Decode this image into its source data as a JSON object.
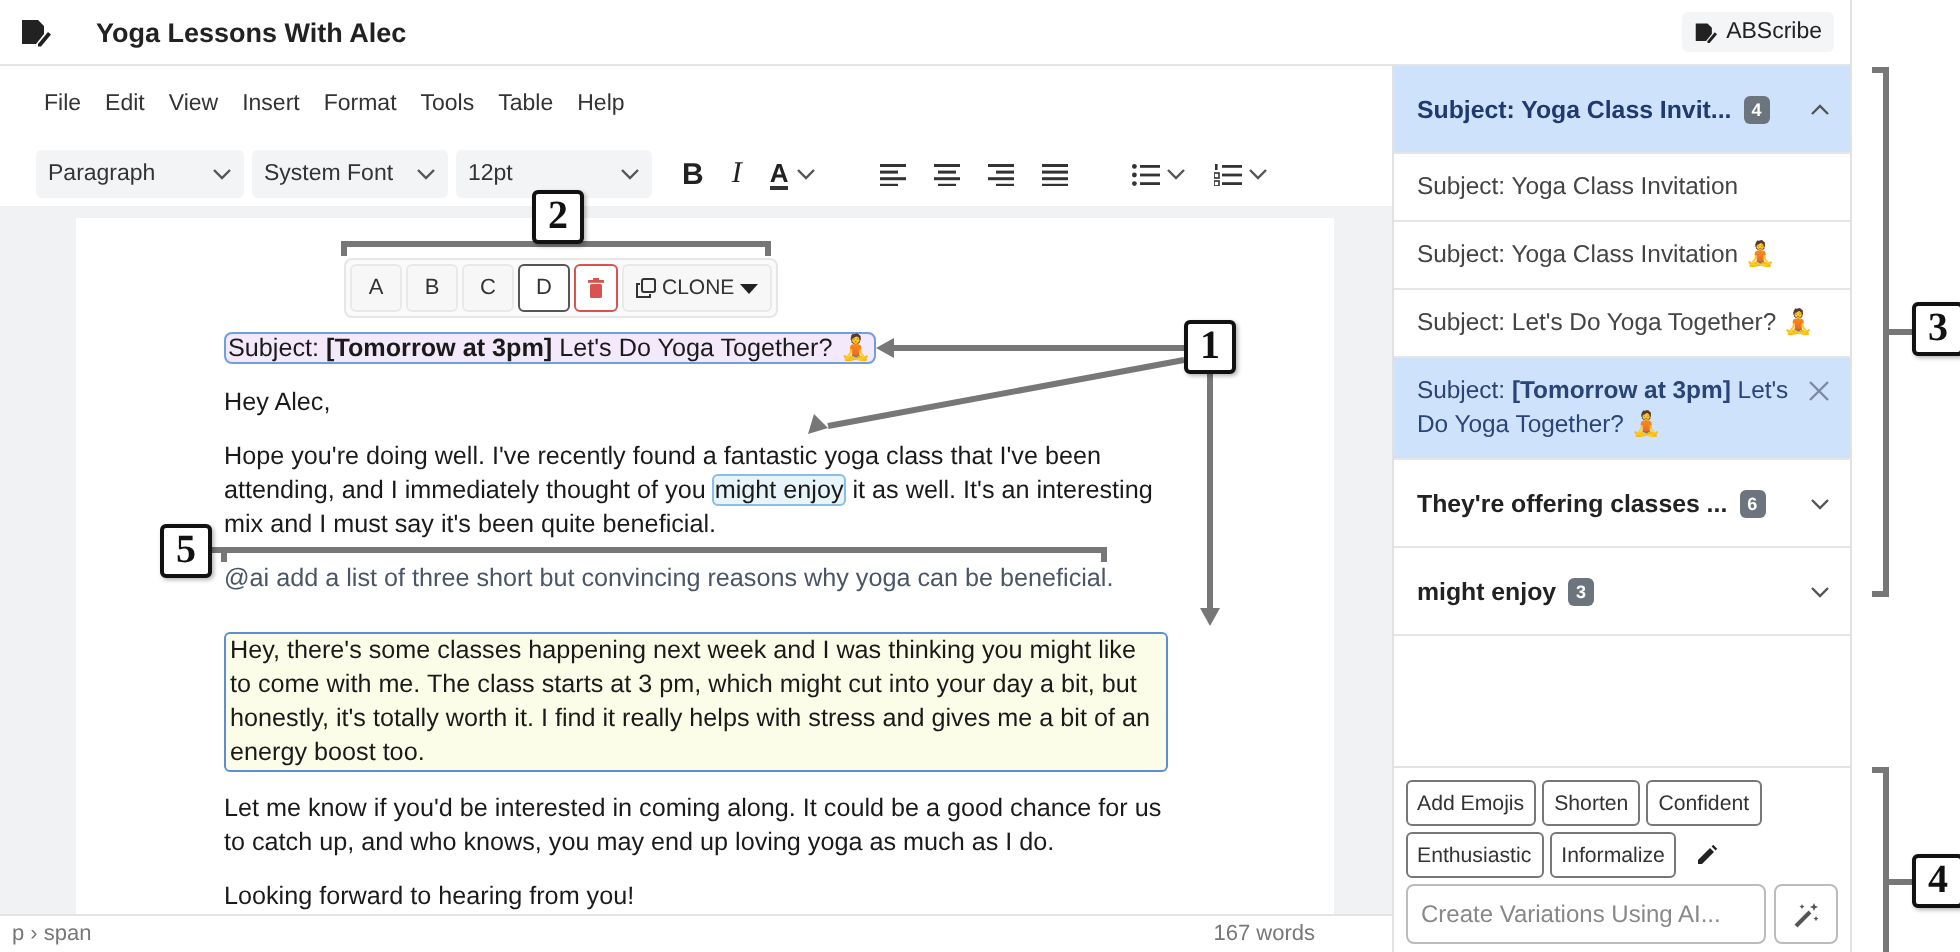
{
  "app": {
    "title": "Yoga Lessons With Alec",
    "brand": "ABScribe"
  },
  "menu": [
    "File",
    "Edit",
    "View",
    "Insert",
    "Format",
    "Tools",
    "Table",
    "Help"
  ],
  "toolbar": {
    "block_format": "Paragraph",
    "font": "System Font",
    "size": "12pt",
    "format_buttons": [
      {
        "kind": "bold",
        "label": "B"
      },
      {
        "kind": "italic",
        "label": "I"
      },
      {
        "kind": "text_color",
        "label": "A"
      }
    ]
  },
  "variation_bar": {
    "variations": [
      {
        "label": "A",
        "selected": false
      },
      {
        "label": "B",
        "selected": false
      },
      {
        "label": "C",
        "selected": false
      },
      {
        "label": "D",
        "selected": true
      }
    ],
    "clone": "CLONE"
  },
  "document": {
    "paragraphs": [
      {
        "kind": "subject",
        "text": "Subject: **[Tomorrow at 3pm]** Let's Do Yoga Together? 🧘"
      },
      {
        "kind": "plain",
        "text": "Hey Alec,"
      },
      {
        "kind": "segmented",
        "segments": [
          {
            "text": "Hope you're doing well. I've recently found a fantastic yoga class that I've been attending, and I immediately thought of you ",
            "highlighted": false
          },
          {
            "text": "might enjoy",
            "highlighted": true
          },
          {
            "text": " it as well. It's an interesting mix and I must say it's been quite beneficial.",
            "highlighted": false
          }
        ]
      },
      {
        "kind": "ai_prompt",
        "text": "@ai add a list of three short but convincing reasons why yoga can be beneficial."
      },
      {
        "kind": "variation",
        "text": "Hey, there's some classes happening next week and I was thinking you might like to come with me. The class starts at 3 pm, which might cut into your day a bit, but honestly, it's totally worth it. I find it really helps with stress and gives me a bit of an energy boost too."
      },
      {
        "kind": "plain",
        "text": "Let me know if you'd be interested in coming along. It could be a good chance for us to catch up, and who knows, you may end up loving yoga as much as I do."
      },
      {
        "kind": "plain",
        "text": "Looking forward to hearing from you!"
      }
    ]
  },
  "status_bar": {
    "path": "p › span",
    "word_count": "167 words"
  },
  "sidebar": {
    "groups": [
      {
        "title": "Subject: Yoga Class Invit...",
        "count": "4",
        "expanded": true,
        "variations": [
          {
            "text": "Subject: Yoga Class Invitation",
            "selected": false
          },
          {
            "text": "Subject: Yoga Class Invitation 🧘",
            "selected": false
          },
          {
            "text": "Subject: Let's Do Yoga Together? 🧘",
            "selected": false
          },
          {
            "text": "Subject: **[Tomorrow at 3pm]** Let's Do Yoga Together? 🧘",
            "selected": true
          }
        ]
      },
      {
        "title": "They're offering classes ...",
        "count": "6",
        "expanded": false
      },
      {
        "title": "might enjoy",
        "count": "3",
        "expanded": false
      }
    ]
  },
  "ai_controls": {
    "recipes": [
      "Add Emojis",
      "Shorten",
      "Confident",
      "Enthusiastic",
      "Informalize"
    ],
    "placeholder": "Create Variations Using AI..."
  },
  "callouts": [
    "1",
    "2",
    "3",
    "4",
    "5"
  ]
}
